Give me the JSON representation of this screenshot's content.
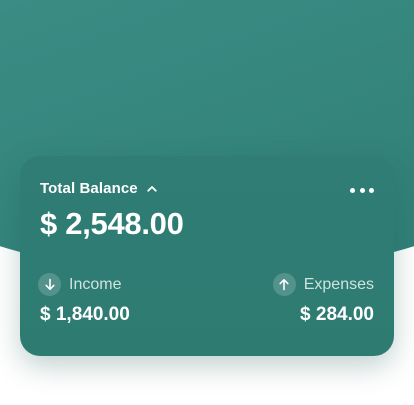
{
  "card": {
    "balance_label": "Total Balance",
    "balance_amount": "$ 2,548.00",
    "toggle_icon": "chevron-up-icon",
    "menu_icon": "more-horizontal-icon",
    "income": {
      "label": "Income",
      "value": "$ 1,840.00",
      "icon": "arrow-down-icon"
    },
    "expenses": {
      "label": "Expenses",
      "value": "$ 284.00",
      "icon": "arrow-up-icon"
    }
  },
  "colors": {
    "header_background": "#3a8c83",
    "card_background": "#2f7d74",
    "muted_text": "#cfe3df"
  }
}
